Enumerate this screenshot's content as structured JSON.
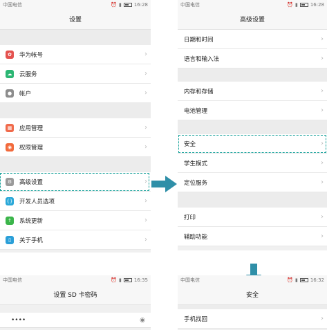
{
  "colors": {
    "accent": "#1ba39c",
    "huawei": "#e4524f",
    "cloud": "#2bb673",
    "account": "#8d8d8d",
    "apps": "#f06a4b",
    "perm": "#f26a3c",
    "advanced": "#9a9a9a",
    "dev": "#2aa8d8",
    "update": "#3bb54a",
    "about": "#2a9fd8"
  },
  "panel1": {
    "carrier": "中国电信",
    "time": "16:28",
    "title": "设置",
    "items": [
      {
        "label": "华为帐号",
        "icon": "huawei-account-icon"
      },
      {
        "label": "云服务",
        "icon": "cloud-icon"
      },
      {
        "label": "帐户",
        "icon": "user-icon"
      },
      {
        "label": "应用管理",
        "icon": "apps-icon"
      },
      {
        "label": "权限管理",
        "icon": "permission-icon"
      },
      {
        "label": "高级设置",
        "icon": "gear-icon"
      },
      {
        "label": "开发人员选项",
        "icon": "developer-icon"
      },
      {
        "label": "系统更新",
        "icon": "update-icon"
      },
      {
        "label": "关于手机",
        "icon": "info-icon"
      }
    ]
  },
  "panel2": {
    "carrier": "中国电信",
    "time": "16:28",
    "title": "高级设置",
    "items": [
      {
        "label": "日期和时间"
      },
      {
        "label": "语言和输入法"
      },
      {
        "label": "内存和存储"
      },
      {
        "label": "电池管理"
      },
      {
        "label": "安全"
      },
      {
        "label": "学生模式"
      },
      {
        "label": "定位服务"
      },
      {
        "label": "打印"
      },
      {
        "label": "辅助功能"
      }
    ]
  },
  "panel3": {
    "carrier": "中国电信",
    "time": "16:35",
    "title": "设置 SD 卡密码",
    "password": "••••"
  },
  "panel4": {
    "carrier": "中国电信",
    "time": "16:32",
    "title": "安全",
    "items": [
      {
        "label": "手机找回"
      }
    ]
  }
}
